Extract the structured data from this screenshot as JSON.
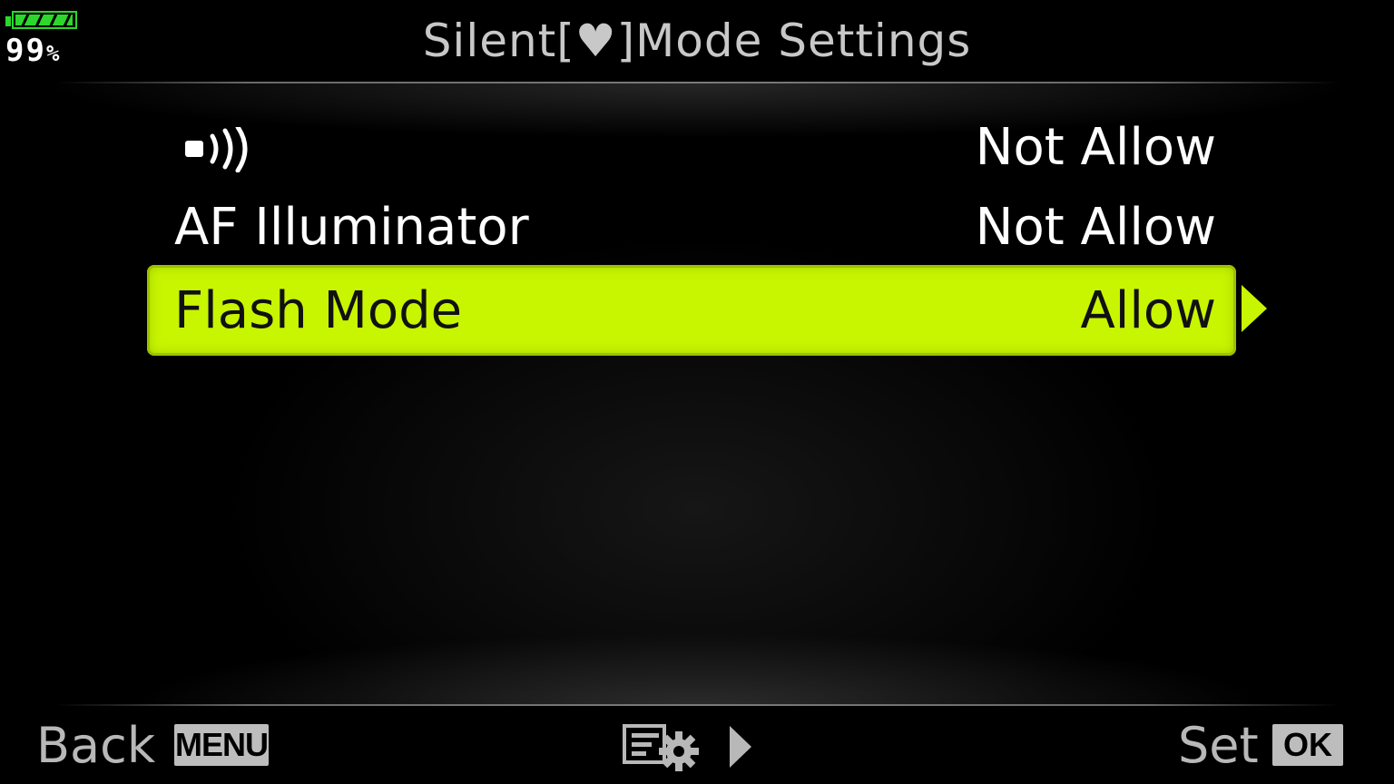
{
  "header": {
    "title": "Silent[♥]Mode Settings"
  },
  "battery": {
    "level_fraction": 0.99,
    "percent_number": "99",
    "percent_symbol": "%",
    "color": "#2bd82b"
  },
  "menu": {
    "items": [
      {
        "icon": "beep-sound-icon",
        "label": "",
        "value": "Not Allow",
        "selected": false
      },
      {
        "label": "AF Illuminator",
        "value": "Not Allow",
        "selected": false
      },
      {
        "label": "Flash Mode",
        "value": "Allow",
        "selected": true
      }
    ],
    "highlight_color": "#c8f500"
  },
  "footer": {
    "back_label": "Back",
    "back_key": "MENU",
    "settings_icon": "menu-settings-icon",
    "next_icon": "right-arrow-icon",
    "set_label": "Set",
    "set_key": "OK"
  }
}
